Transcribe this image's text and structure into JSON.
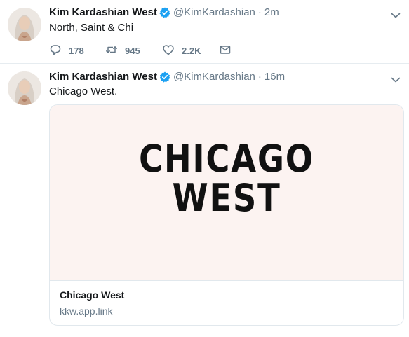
{
  "tweets": [
    {
      "name": "Kim Kardashian West",
      "handle": "@KimKardashian",
      "separator": "·",
      "time": "2m",
      "text": "North, Saint & Chi",
      "replies": "178",
      "retweets": "945",
      "likes": "2.2K"
    },
    {
      "name": "Kim Kardashian West",
      "handle": "@KimKardashian",
      "separator": "·",
      "time": "16m",
      "text": "Chicago West.",
      "card": {
        "image_line1": "CHICAGO",
        "image_line2": "WEST",
        "title": "Chicago West",
        "link": "kkw.app.link"
      }
    }
  ],
  "colors": {
    "verified": "#1da1f2",
    "secondary_text": "#657786",
    "card_background": "#fcf3f1"
  }
}
